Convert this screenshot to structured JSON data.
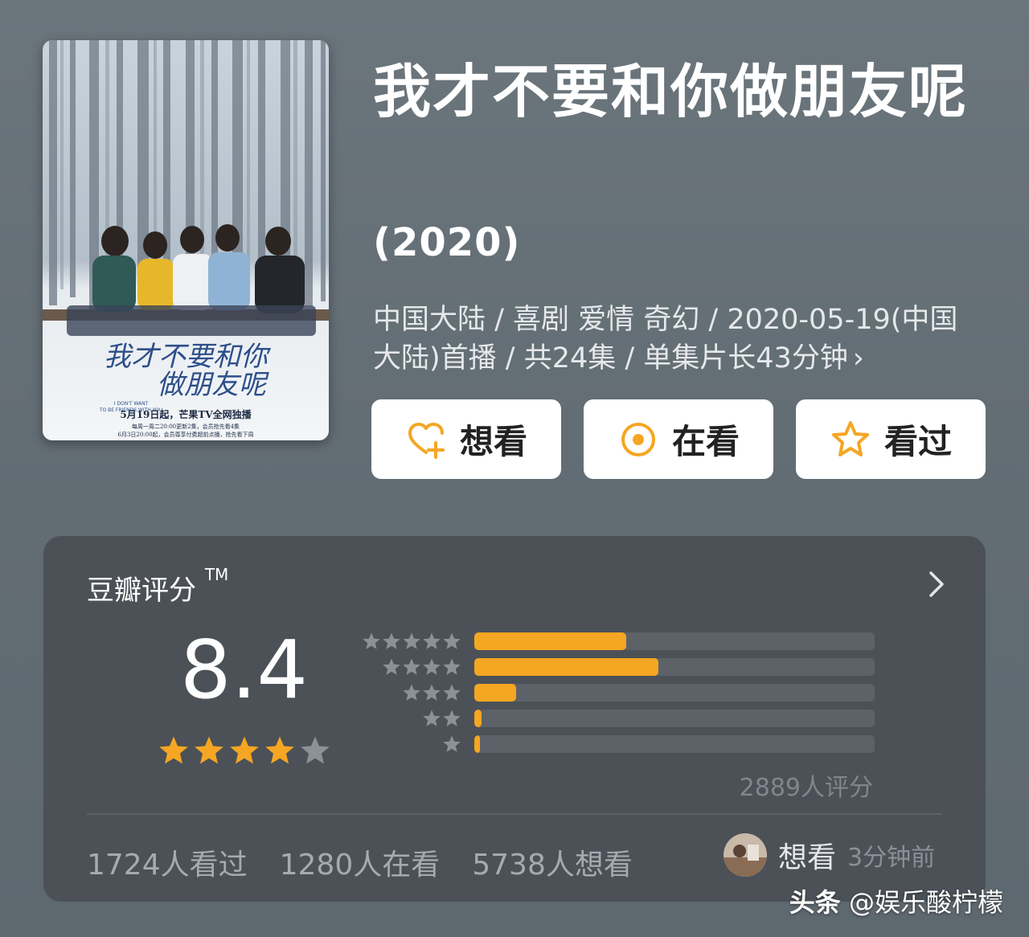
{
  "movie": {
    "title": "我才不要和你做朋友呢",
    "year": "(2020)",
    "meta": "中国大陆 / 喜剧 爱情 奇幻 / 2020-05-19(中国大陆)首播 / 共24集 / 单集片长43分钟",
    "meta_chevron": "›"
  },
  "poster": {
    "calligraphy_line1": "我才不要和你",
    "calligraphy_line2": "做朋友呢",
    "english_line1": "I DON'T WANT",
    "english_line2": "TO BE FRIENDS WITH YOU",
    "release_line": "5月19日起，芒果TV全网独播",
    "schedule_line1": "每周一周二20:00更新2集，会员抢先看4集",
    "schedule_line2": "6月3日20:00起，会员尊享付费超前点播，抢先看下周"
  },
  "actions": [
    {
      "label": "想看",
      "icon": "heart-plus-icon"
    },
    {
      "label": "在看",
      "icon": "target-circle-icon"
    },
    {
      "label": "看过",
      "icon": "star-outline-icon"
    }
  ],
  "rating": {
    "title": "豆瓣评分",
    "tm": "TM",
    "score": "8.4",
    "score_stars": 4,
    "rating_count": "2889人评分",
    "distribution": [
      {
        "stars": 5,
        "fraction": 0.38
      },
      {
        "stars": 4,
        "fraction": 0.46
      },
      {
        "stars": 3,
        "fraction": 0.105
      },
      {
        "stars": 2,
        "fraction": 0.018
      },
      {
        "stars": 1,
        "fraction": 0.012
      }
    ],
    "stats": {
      "watched": "1724人看过",
      "watching": "1280人在看",
      "want": "5738人想看"
    },
    "activity": {
      "label": "想看",
      "time": "3分钟前"
    }
  },
  "watermark": {
    "brand": "头条",
    "handle": "@娱乐酸柠檬"
  },
  "colors": {
    "accent": "#f5a623",
    "card_bg": "#4b5157",
    "bar_track": "#5c6268"
  }
}
